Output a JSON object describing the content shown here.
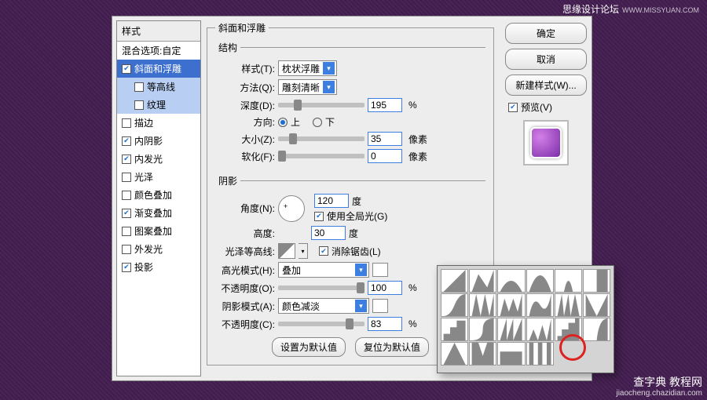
{
  "watermark": {
    "top": "思缘设计论坛",
    "top_url": "WWW.MISSYUAN.COM",
    "bottom": "查字典 教程网",
    "bottom_sub": "jiaocheng.chazidian.com"
  },
  "left": {
    "hdr": "样式",
    "blend": "混合选项:自定",
    "items": {
      "bevel": "斜面和浮雕",
      "contour": "等高线",
      "texture": "纹理",
      "stroke": "描边",
      "inner_shadow": "内阴影",
      "inner_glow": "内发光",
      "satin": "光泽",
      "color_overlay": "颜色叠加",
      "grad_overlay": "渐变叠加",
      "pat_overlay": "图案叠加",
      "outer_glow": "外发光",
      "drop_shadow": "投影"
    }
  },
  "main_title": "斜面和浮雕",
  "structure": {
    "legend": "结构",
    "style_lbl": "样式(T):",
    "style_val": "枕状浮雕",
    "method_lbl": "方法(Q):",
    "method_val": "雕刻清晰",
    "depth_lbl": "深度(D):",
    "depth_val": "195",
    "depth_unit": "%",
    "dir_lbl": "方向:",
    "dir_up": "上",
    "dir_down": "下",
    "size_lbl": "大小(Z):",
    "size_val": "35",
    "size_unit": "像素",
    "soft_lbl": "软化(F):",
    "soft_val": "0",
    "soft_unit": "像素"
  },
  "shading": {
    "legend": "阴影",
    "angle_lbl": "角度(N):",
    "angle_val": "120",
    "angle_unit": "度",
    "global_lbl": "使用全局光(G)",
    "alt_lbl": "高度:",
    "alt_val": "30",
    "alt_unit": "度",
    "gloss_lbl": "光泽等高线:",
    "aa_lbl": "消除锯齿(L)",
    "hi_mode_lbl": "高光模式(H):",
    "hi_mode_val": "叠加",
    "hi_op_lbl": "不透明度(O):",
    "hi_op_val": "100",
    "op_unit": "%",
    "sh_mode_lbl": "阴影模式(A):",
    "sh_mode_val": "颜色减淡",
    "sh_op_lbl": "不透明度(C):",
    "sh_op_val": "83"
  },
  "footer": {
    "default": "设置为默认值",
    "reset": "复位为默认值"
  },
  "right": {
    "ok": "确定",
    "cancel": "取消",
    "new_style": "新建样式(W)...",
    "preview": "预览(V)"
  }
}
